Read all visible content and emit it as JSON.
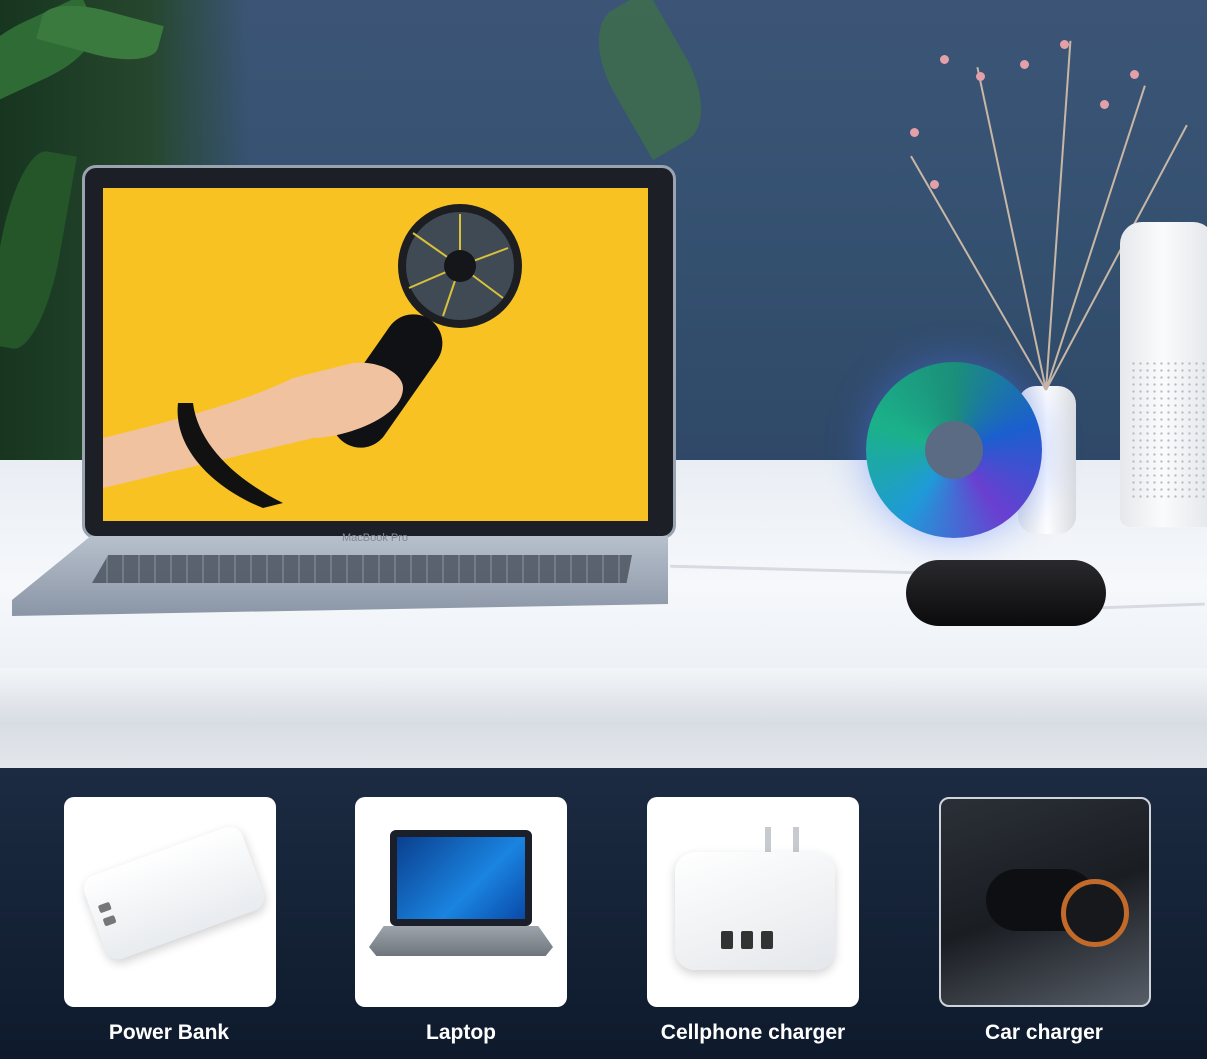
{
  "screen_label": "MacBook Pro",
  "compatible_sources": [
    {
      "label": "Power Bank",
      "icon": "power-bank-image"
    },
    {
      "label": "Laptop",
      "icon": "laptop-image"
    },
    {
      "label": "Cellphone charger",
      "icon": "wall-charger-image"
    },
    {
      "label": "Car charger",
      "icon": "car-charger-image"
    }
  ],
  "colors": {
    "screen_yellow": "#f8c322",
    "desk_white": "#f3f5f8",
    "wall_blue": "#34506f",
    "label_text": "#ffffff"
  }
}
